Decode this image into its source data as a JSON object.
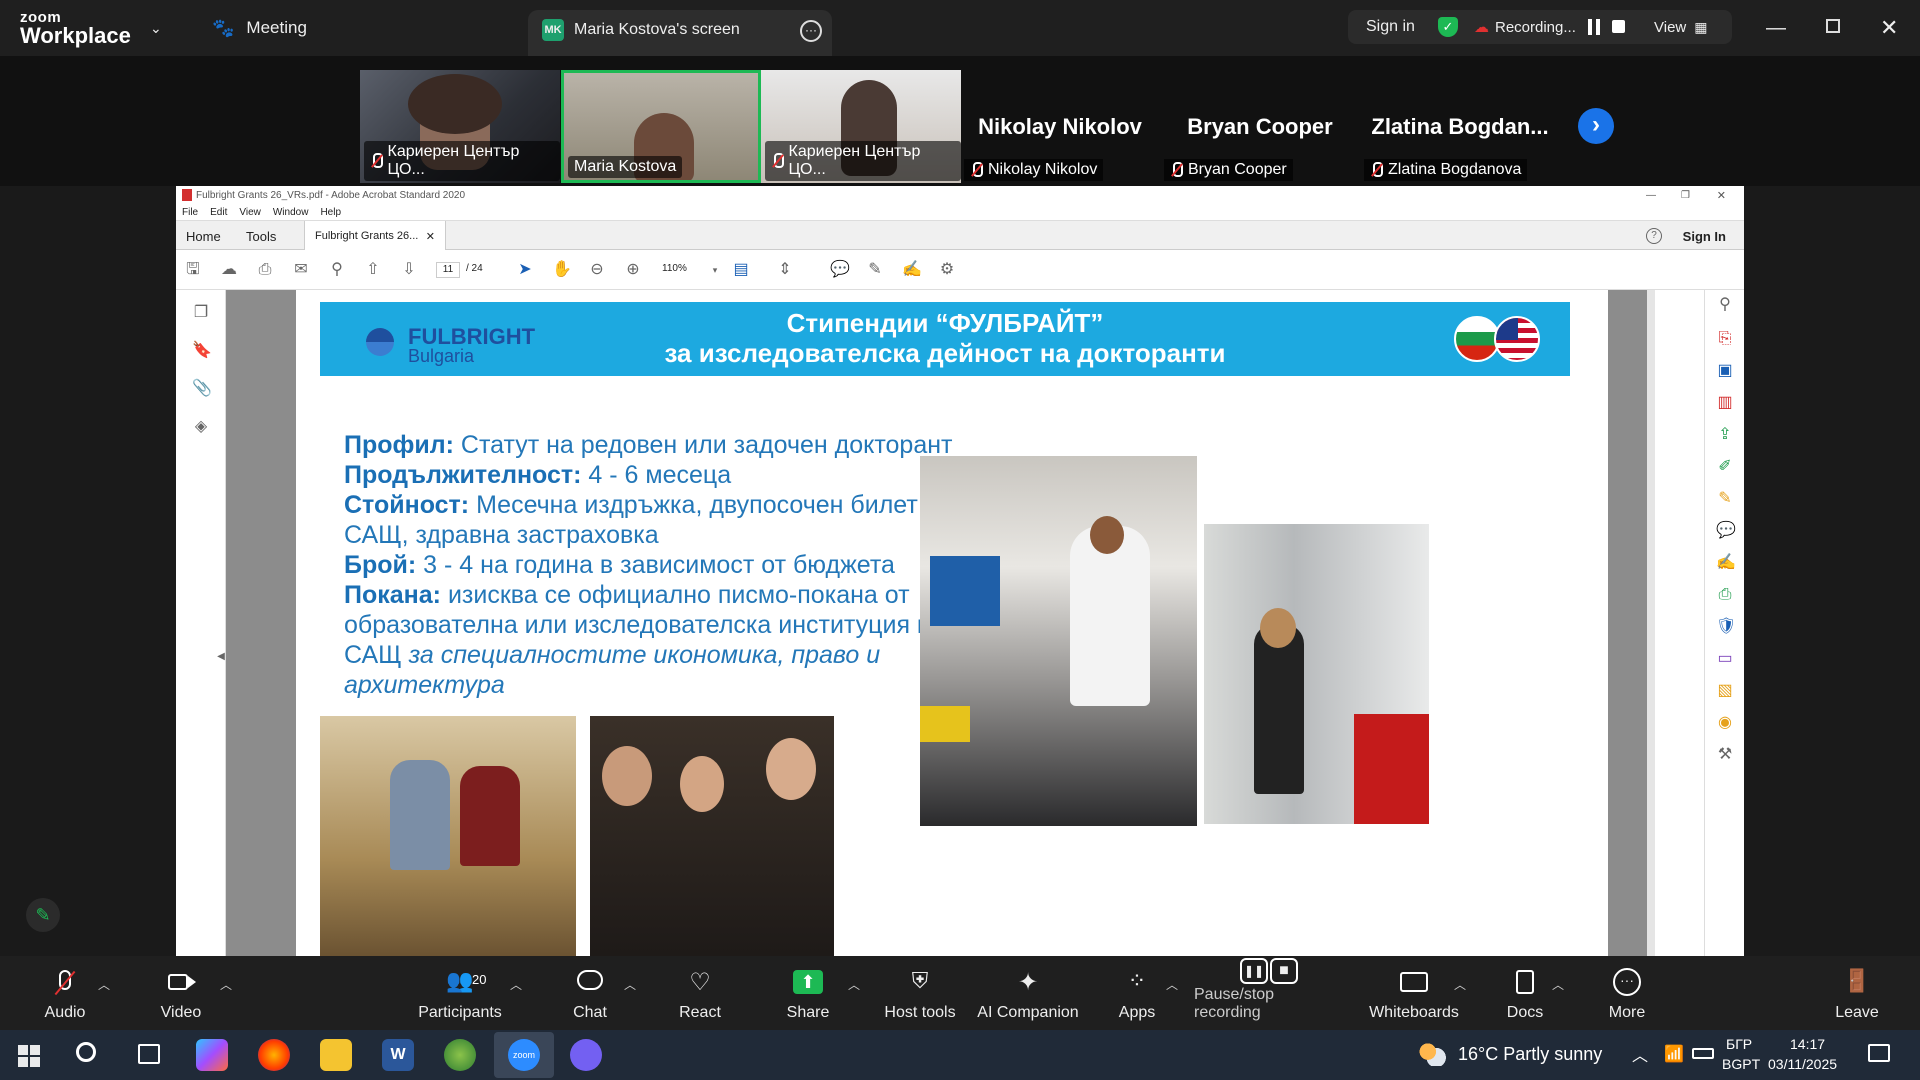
{
  "topbar": {
    "brand_small": "zoom",
    "brand_big": "Workplace",
    "meeting_label": "Meeting",
    "screen_share_tab": "Maria Kostova's screen",
    "screen_initials": "MK",
    "sign_in": "Sign in",
    "recording": "Recording...",
    "view": "View"
  },
  "participants_strip": [
    {
      "label": "Кариерен Център ЦО..."
    },
    {
      "label": "Maria Kostova",
      "active": true
    },
    {
      "label": "Кариерен Център ЦО..."
    },
    {
      "name": "Nikolay Nikolov",
      "label": "Nikolay Nikolov"
    },
    {
      "name": "Bryan Cooper",
      "label": "Bryan Cooper"
    },
    {
      "name": "Zlatina  Bogdan...",
      "label": "Zlatina Bogdanova"
    }
  ],
  "acrobat": {
    "window_title": "Fulbright Grants 26_VRs.pdf - Adobe Acrobat Standard 2020",
    "menu": [
      "File",
      "Edit",
      "View",
      "Window",
      "Help"
    ],
    "tabs": {
      "home": "Home",
      "tools": "Tools",
      "doc": "Fulbright Grants 26..."
    },
    "sign_in": "Sign In",
    "page_current": "11",
    "page_total": "/ 24",
    "zoom": "110%"
  },
  "slide": {
    "logo_top": "FULBRIGHT",
    "logo_bottom": "Bulgaria",
    "title1": "Стипендии “ФУЛБРАЙТ”",
    "title2": "за изследователска дейност на докторанти",
    "profile_k": "Профил:",
    "profile_v": " Статут на редовен или задочен докторант",
    "duration_k": "Продължителност:",
    "duration_v": " 4 - 6 месеца",
    "value_k": "Стойност:",
    "value_v": " Месечна издръжка, двупосочен билет до САЩ,  здравна застраховка",
    "count_k": "Брой:",
    "count_v": " 3 - 4 на година в зависимост от бюджета",
    "invite_k": "Покана:",
    "invite_v": " изисква се официално писмо-покана от  образователна или изследователска институция в САЩ ",
    "invite_i": "за  специалностите икономика, право и архитектура"
  },
  "bottom_toolbar": {
    "audio": "Audio",
    "video": "Video",
    "participants": "Participants",
    "participants_count": "20",
    "chat": "Chat",
    "react": "React",
    "share": "Share",
    "host_tools": "Host tools",
    "ai_companion": "AI Companion",
    "apps": "Apps",
    "pause_stop": "Pause/stop recording",
    "whiteboards": "Whiteboards",
    "docs": "Docs",
    "more": "More",
    "leave": "Leave"
  },
  "taskbar": {
    "weather": "16°C  Partly sunny",
    "lang1": "БГР",
    "lang2": "BGPT",
    "time": "14:17",
    "date": "03/11/2025"
  },
  "colors": {
    "banner": "#1da9e0",
    "slide_text": "#2377b8",
    "share_green": "#1db954",
    "leave_red": "#e03030"
  }
}
